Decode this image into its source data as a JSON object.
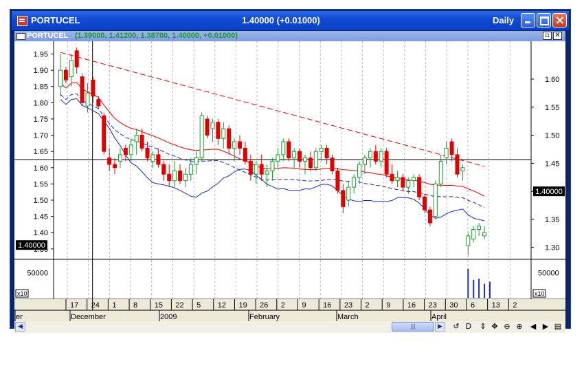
{
  "window": {
    "symbol": "PORTUCEL",
    "price_header": "1.40000 (+0.01000)",
    "period": "Daily"
  },
  "subwindow": {
    "symbol": "PORTUCEL",
    "ohlc": "(1.39000, 1.41200, 1.38700, 1.40000, +0.01000)"
  },
  "colors": {
    "up": "#1a9a2a",
    "down": "#e00000",
    "ma": "#e00000",
    "band": "#1a2ac8",
    "accent": "#0a3fc4"
  },
  "chart_data": {
    "type": "candlestick",
    "left_axis": {
      "ticks": [
        "1.95",
        "1.90",
        "1.85",
        "1.80",
        "1.75",
        "1.70",
        "1.65",
        "1.60",
        "1.55",
        "1.50",
        "1.45",
        "1.40",
        "1.35"
      ],
      "current": "1.40000",
      "range": [
        1.32,
        1.985
      ]
    },
    "right_axis": {
      "ticks": [
        "1.60",
        "1.55",
        "1.50",
        "1.45",
        "1.40",
        "1.35",
        "1.30"
      ],
      "current": "1.40000"
    },
    "volume_axis": {
      "ticks": [
        "50000"
      ],
      "multiplier": "x10"
    },
    "date_ticks": [
      "17",
      "24",
      "1",
      "8",
      "15",
      "22",
      "5",
      "12",
      "19",
      "26",
      "2",
      "9",
      "16",
      "23",
      "2",
      "9",
      "16",
      "23",
      "30",
      "6",
      "13",
      "2"
    ],
    "month_labels": [
      "er",
      "December",
      "2009",
      "February",
      "March",
      "April"
    ],
    "candles": [
      [
        1.85,
        1.95,
        1.82,
        1.9
      ],
      [
        1.9,
        1.91,
        1.86,
        1.87
      ],
      [
        1.88,
        1.95,
        1.85,
        1.93
      ],
      [
        1.96,
        1.97,
        1.89,
        1.91
      ],
      [
        1.88,
        1.89,
        1.79,
        1.8
      ],
      [
        1.79,
        1.86,
        1.77,
        1.83
      ],
      [
        1.87,
        1.88,
        1.8,
        1.82
      ],
      [
        1.81,
        1.82,
        1.78,
        1.79
      ],
      [
        1.76,
        1.77,
        1.64,
        1.65
      ],
      [
        1.63,
        1.66,
        1.59,
        1.61
      ],
      [
        1.61,
        1.63,
        1.58,
        1.6
      ],
      [
        1.62,
        1.66,
        1.6,
        1.64
      ],
      [
        1.66,
        1.67,
        1.62,
        1.64
      ],
      [
        1.64,
        1.69,
        1.62,
        1.67
      ],
      [
        1.68,
        1.72,
        1.64,
        1.7
      ],
      [
        1.7,
        1.72,
        1.65,
        1.66
      ],
      [
        1.66,
        1.68,
        1.62,
        1.63
      ],
      [
        1.62,
        1.65,
        1.6,
        1.64
      ],
      [
        1.64,
        1.66,
        1.6,
        1.61
      ],
      [
        1.61,
        1.62,
        1.56,
        1.58
      ],
      [
        1.58,
        1.61,
        1.54,
        1.56
      ],
      [
        1.56,
        1.62,
        1.54,
        1.59
      ],
      [
        1.59,
        1.61,
        1.55,
        1.56
      ],
      [
        1.56,
        1.6,
        1.54,
        1.58
      ],
      [
        1.58,
        1.63,
        1.56,
        1.61
      ],
      [
        1.61,
        1.65,
        1.58,
        1.63
      ],
      [
        1.63,
        1.77,
        1.62,
        1.76
      ],
      [
        1.75,
        1.76,
        1.69,
        1.7
      ],
      [
        1.72,
        1.75,
        1.68,
        1.74
      ],
      [
        1.74,
        1.75,
        1.67,
        1.69
      ],
      [
        1.69,
        1.74,
        1.66,
        1.72
      ],
      [
        1.72,
        1.73,
        1.64,
        1.66
      ],
      [
        1.66,
        1.69,
        1.62,
        1.68
      ],
      [
        1.68,
        1.7,
        1.64,
        1.66
      ],
      [
        1.66,
        1.68,
        1.61,
        1.62
      ],
      [
        1.62,
        1.64,
        1.56,
        1.58
      ],
      [
        1.58,
        1.62,
        1.55,
        1.61
      ],
      [
        1.61,
        1.64,
        1.56,
        1.58
      ],
      [
        1.58,
        1.61,
        1.54,
        1.59
      ],
      [
        1.59,
        1.63,
        1.56,
        1.62
      ],
      [
        1.62,
        1.66,
        1.6,
        1.64
      ],
      [
        1.64,
        1.69,
        1.62,
        1.68
      ],
      [
        1.68,
        1.69,
        1.62,
        1.63
      ],
      [
        1.63,
        1.66,
        1.6,
        1.65
      ],
      [
        1.65,
        1.66,
        1.6,
        1.62
      ],
      [
        1.62,
        1.64,
        1.58,
        1.63
      ],
      [
        1.63,
        1.65,
        1.59,
        1.6
      ],
      [
        1.6,
        1.66,
        1.59,
        1.65
      ],
      [
        1.65,
        1.67,
        1.62,
        1.66
      ],
      [
        1.66,
        1.67,
        1.61,
        1.63
      ],
      [
        1.63,
        1.64,
        1.58,
        1.59
      ],
      [
        1.59,
        1.6,
        1.52,
        1.53
      ],
      [
        1.53,
        1.55,
        1.46,
        1.48
      ],
      [
        1.5,
        1.56,
        1.48,
        1.54
      ],
      [
        1.54,
        1.58,
        1.52,
        1.57
      ],
      [
        1.57,
        1.62,
        1.55,
        1.61
      ],
      [
        1.61,
        1.64,
        1.58,
        1.63
      ],
      [
        1.63,
        1.66,
        1.6,
        1.65
      ],
      [
        1.65,
        1.67,
        1.61,
        1.62
      ],
      [
        1.62,
        1.66,
        1.6,
        1.65
      ],
      [
        1.65,
        1.66,
        1.57,
        1.58
      ],
      [
        1.58,
        1.61,
        1.55,
        1.56
      ],
      [
        1.56,
        1.59,
        1.54,
        1.57
      ],
      [
        1.57,
        1.58,
        1.53,
        1.54
      ],
      [
        1.54,
        1.57,
        1.52,
        1.56
      ],
      [
        1.56,
        1.58,
        1.54,
        1.57
      ],
      [
        1.57,
        1.58,
        1.5,
        1.51
      ],
      [
        1.51,
        1.52,
        1.46,
        1.47
      ],
      [
        1.47,
        1.48,
        1.42,
        1.43
      ],
      [
        1.45,
        1.56,
        1.44,
        1.55
      ],
      [
        1.55,
        1.64,
        1.54,
        1.62
      ],
      [
        1.63,
        1.68,
        1.61,
        1.66
      ],
      [
        1.68,
        1.69,
        1.62,
        1.64
      ],
      [
        1.64,
        1.66,
        1.57,
        1.58
      ],
      [
        1.59,
        1.61,
        1.56,
        1.6
      ],
      [
        1.36,
        1.4,
        1.33,
        1.39
      ],
      [
        1.38,
        1.42,
        1.37,
        1.41
      ],
      [
        1.41,
        1.43,
        1.39,
        1.42
      ],
      [
        1.39,
        1.42,
        1.38,
        1.4
      ]
    ],
    "volume_x10": [
      0,
      0,
      0,
      0,
      0,
      0,
      0,
      0,
      0,
      0,
      0,
      0,
      0,
      0,
      0,
      0,
      0,
      0,
      0,
      0,
      0,
      0,
      0,
      0,
      0,
      0,
      0,
      0,
      0,
      0,
      0,
      0,
      0,
      0,
      0,
      0,
      0,
      0,
      0,
      0,
      0,
      0,
      0,
      0,
      0,
      0,
      0,
      0,
      0,
      0,
      0,
      0,
      0,
      0,
      0,
      0,
      0,
      0,
      0,
      0,
      0,
      0,
      0,
      0,
      0,
      0,
      0,
      0,
      0,
      0,
      0,
      0,
      0,
      0,
      0,
      58000,
      36000,
      38000,
      28000,
      32000
    ],
    "horizontal_line": 1.625
  }
}
